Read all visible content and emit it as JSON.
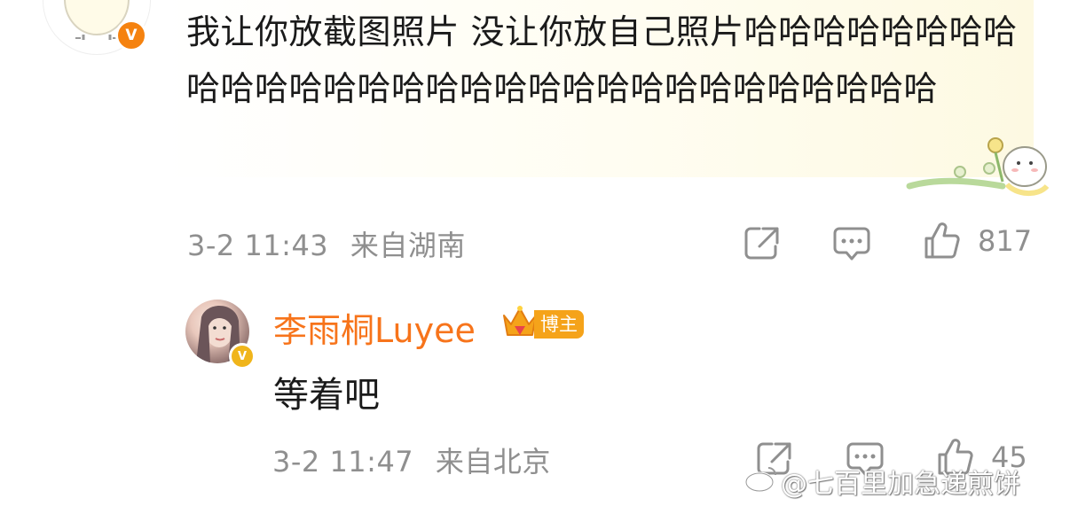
{
  "comment1": {
    "text": "我让你放截图照片 没让你放自己照片哈哈哈哈哈哈哈哈哈哈哈哈哈哈哈哈哈哈哈哈哈哈哈哈哈哈哈哈哈哈",
    "verified_badge": "V",
    "time": "3-2 11:43",
    "location": "来自湖南",
    "like_count": "817"
  },
  "reply": {
    "author": "李雨桐Luyee",
    "author_tag": "博主",
    "verified_badge": "V",
    "text": "等着吧",
    "time": "3-2 11:47",
    "location": "来自北京",
    "like_count": "45"
  },
  "watermark": "@七百里加急递煎饼",
  "colors": {
    "accent_orange": "#f7741b",
    "verified_orange": "#f5820f",
    "meta_gray": "#8f8f8f",
    "text": "#1a1a1a"
  },
  "icons": [
    "share-icon",
    "comment-icon",
    "like-icon",
    "crown-icon",
    "verified-icon",
    "weibo-logo-icon"
  ]
}
